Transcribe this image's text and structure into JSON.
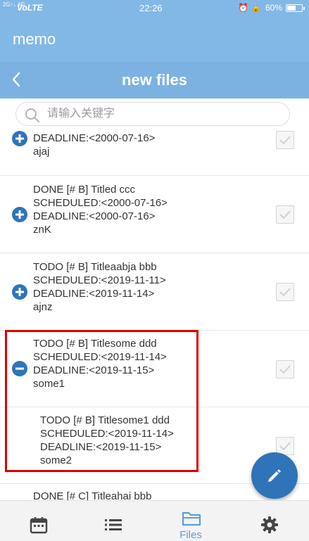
{
  "status_bar": {
    "signal": "2G↑↓ 4G",
    "network": "VoLTE",
    "time": "22:26",
    "battery_text": "60%",
    "battery_level": 0.6
  },
  "app": {
    "title": "memo"
  },
  "subheader": {
    "title": "new files",
    "back_icon": "chevron-left-icon"
  },
  "search": {
    "placeholder": "请输入关键字",
    "value": ""
  },
  "items": [
    {
      "lines": [
        "DEADLINE:<2000-07-16>",
        "ajaj"
      ],
      "toggle": "expand",
      "checked": true
    },
    {
      "lines": [
        "DONE [# B] Titled ccc",
        "SCHEDULED:<2000-07-16>",
        "DEADLINE:<2000-07-16>",
        "znK"
      ],
      "toggle": "expand",
      "checked": true
    },
    {
      "lines": [
        "TODO [# B] Titleaabja bbb",
        "SCHEDULED:<2019-11-11>",
        "DEADLINE:<2019-11-14>",
        "ajnz"
      ],
      "toggle": "expand",
      "checked": true
    },
    {
      "lines": [
        "TODO [# B] Titlesome ddd",
        "SCHEDULED:<2019-11-14>",
        "DEADLINE:<2019-11-15>",
        "some1"
      ],
      "toggle": "collapse",
      "checked": true
    },
    {
      "lines": [
        "TODO [# B] Titlesome1 ddd",
        "SCHEDULED:<2019-11-14>",
        "DEADLINE:<2019-11-15>",
        "some2"
      ],
      "toggle": "none",
      "checked": true
    },
    {
      "lines": [
        "DONE [# C] Titleahai bbb"
      ],
      "toggle": "none",
      "checked": false
    }
  ],
  "fab": {
    "icon": "pencil-icon"
  },
  "bottom_nav": [
    {
      "icon": "calendar-icon",
      "label": ""
    },
    {
      "icon": "list-icon",
      "label": ""
    },
    {
      "icon": "folder-icon",
      "label": "Files",
      "active": true
    },
    {
      "icon": "gear-icon",
      "label": ""
    }
  ],
  "colors": {
    "accent": "#82b8e6",
    "expand_icon": "#2f74b8",
    "fab": "#2f74b8",
    "active_tab": "#5c9ddb",
    "highlight": "#e00000"
  }
}
